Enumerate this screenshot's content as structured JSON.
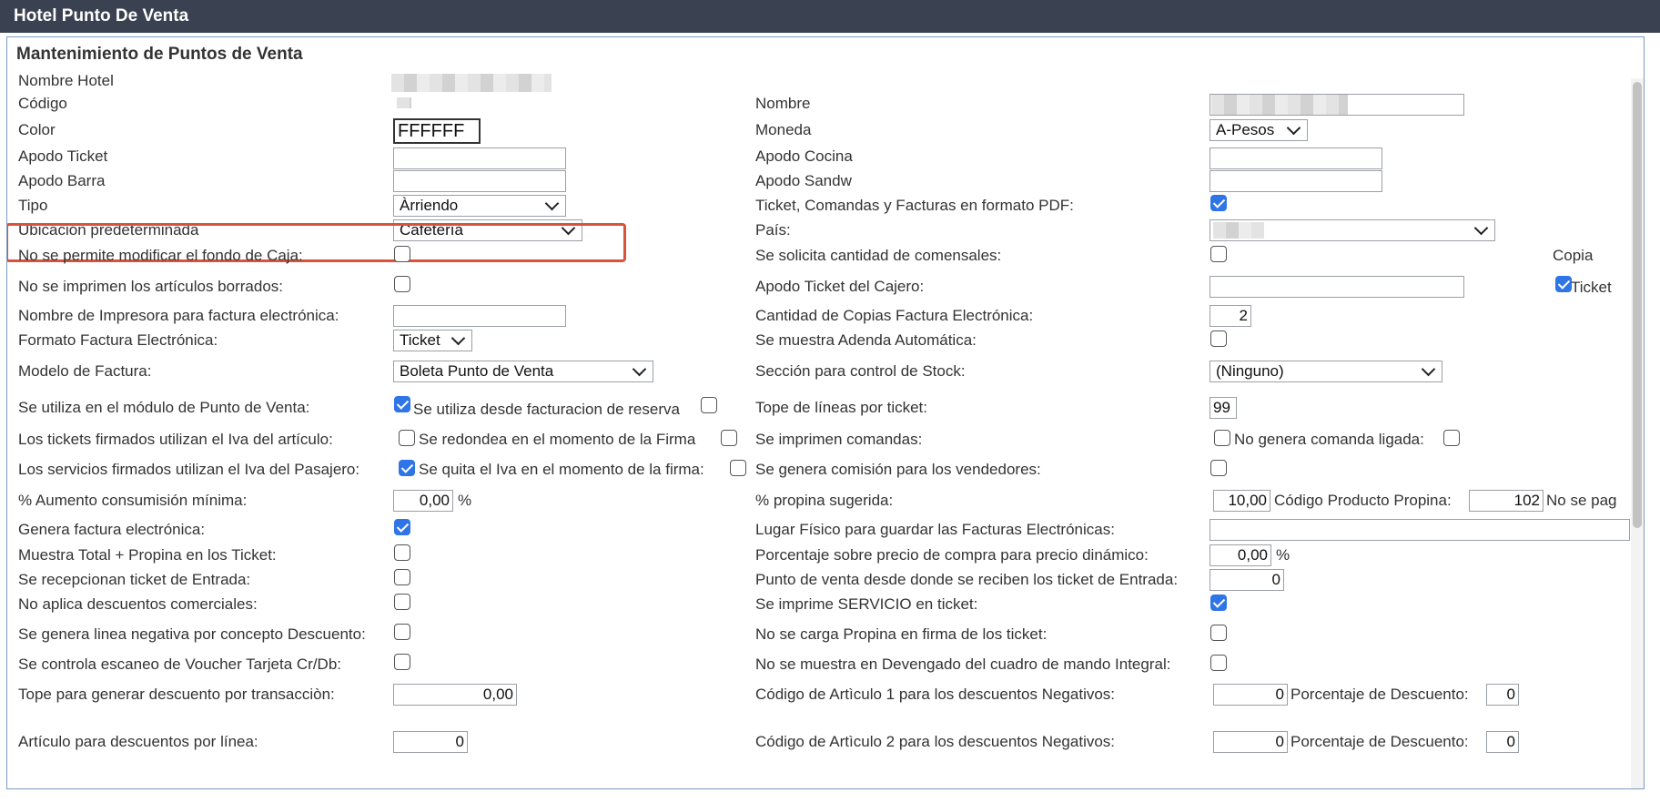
{
  "window": {
    "title": "Hotel Punto De Venta"
  },
  "section": {
    "title": "Mantenimiento de Puntos de Venta"
  },
  "left": {
    "nombre_hotel": "Nombre Hotel",
    "codigo": "Código",
    "color": "Color",
    "color_value": "FFFFFF",
    "apodo_ticket": "Apodo Ticket",
    "apodo_barra": "Apodo Barra",
    "tipo": "Tipo",
    "tipo_value": "Àrriendo",
    "ubicacion": "Ubicación predeterminada",
    "ubicacion_value": "Cafetería",
    "no_modificar_fondo": "No se permite modificar el fondo de Caja:",
    "no_imprimen_borrados": "No se imprimen los artículos borrados:",
    "nombre_impresora": "Nombre de Impresora para factura electrónica:",
    "formato_factura": "Formato Factura Electrónica:",
    "formato_factura_value": "Ticket",
    "modelo_factura": "Modelo de Factura:",
    "modelo_factura_value": "Boleta Punto de Venta",
    "modulo_pv": "Se utiliza en el módulo de Punto de Venta:",
    "facturacion_reserva": "Se utiliza desde facturacion de reserva",
    "tickets_iva": "Los tickets firmados utilizan el Iva del artículo:",
    "redondea_firma": "Se redondea en el momento de la Firma",
    "servicios_iva": "Los servicios firmados utilizan el Iva del Pasajero:",
    "quita_iva": "Se quita el Iva en el momento de la firma:",
    "aumento_consumicion": "% Aumento consumisión mínima:",
    "aumento_value": "0,00",
    "percent": "%",
    "genera_factura": "Genera factura electrónica:",
    "muestra_total": "Muestra Total + Propina en los Ticket:",
    "recepcionan_ticket": "Se recepcionan ticket de Entrada:",
    "no_descuentos": "No aplica descuentos comerciales:",
    "linea_negativa": "Se genera linea negativa por concepto Descuento:",
    "escaneo_voucher": "Se controla escaneo de Voucher Tarjeta Cr/Db:",
    "tope_descuento": "Tope para generar descuento por transacciòn:",
    "tope_descuento_value": "0,00",
    "articulo_descuentos": "Artículo para descuentos por línea:",
    "articulo_descuentos_value": "0"
  },
  "right": {
    "nombre": "Nombre",
    "moneda": "Moneda",
    "moneda_value": "A-Pesos",
    "apodo_cocina": "Apodo Cocina",
    "apodo_sandw": "Apodo Sandw",
    "ticket_pdf": "Ticket, Comandas y Facturas en formato PDF:",
    "pais": "País:",
    "comensales": "Se solicita cantidad de comensales:",
    "copia": "Copia",
    "copia_ticket": "Ticket",
    "apodo_cajero": "Apodo Ticket del Cajero:",
    "cantidad_copias": "Cantidad de Copias Factura Electrónica:",
    "cantidad_copias_value": "2",
    "adenda": "Se muestra Adenda Automática:",
    "seccion_stock": "Sección para control de Stock:",
    "seccion_stock_value": "(Ninguno)",
    "tope_lineas": "Tope de líneas por ticket:",
    "tope_lineas_value": "99",
    "imprimen_comandas": "Se imprimen comandas:",
    "no_comanda_ligada": "No genera comanda ligada:",
    "comision": "Se genera comisión para los vendedores:",
    "propina_sugerida": "% propina sugerida:",
    "propina_value": "10,00",
    "codigo_propina": "Código Producto Propina:",
    "codigo_propina_value": "102",
    "no_se_pag": "No se pag",
    "lugar_fisico": "Lugar Físico para guardar las Facturas Electrónicas:",
    "porcentaje_dinamico": "Porcentaje sobre precio de compra para precio dinámico:",
    "porcentaje_dinamico_value": "0,00",
    "percent": "%",
    "punto_entrada": "Punto de venta desde donde se reciben los ticket de Entrada:",
    "punto_entrada_value": "0",
    "imprime_servicio": "Se imprime SERVICIO en ticket:",
    "no_propina_firma": "No se carga Propina en firma de los ticket:",
    "no_devengado": "No se muestra en Devengado del cuadro de mando Integral:",
    "codigo_art1": "Código de Artìculo 1 para los descuentos Negativos:",
    "codigo_art1_value": "0",
    "porcentaje_desc1": "Porcentaje de Descuento:",
    "porcentaje_desc1_value": "0",
    "codigo_art2": "Código de Artìculo 2 para los descuentos Negativos:",
    "codigo_art2_value": "0",
    "porcentaje_desc2": "Porcentaje de Descuento:",
    "porcentaje_desc2_value": "0"
  }
}
